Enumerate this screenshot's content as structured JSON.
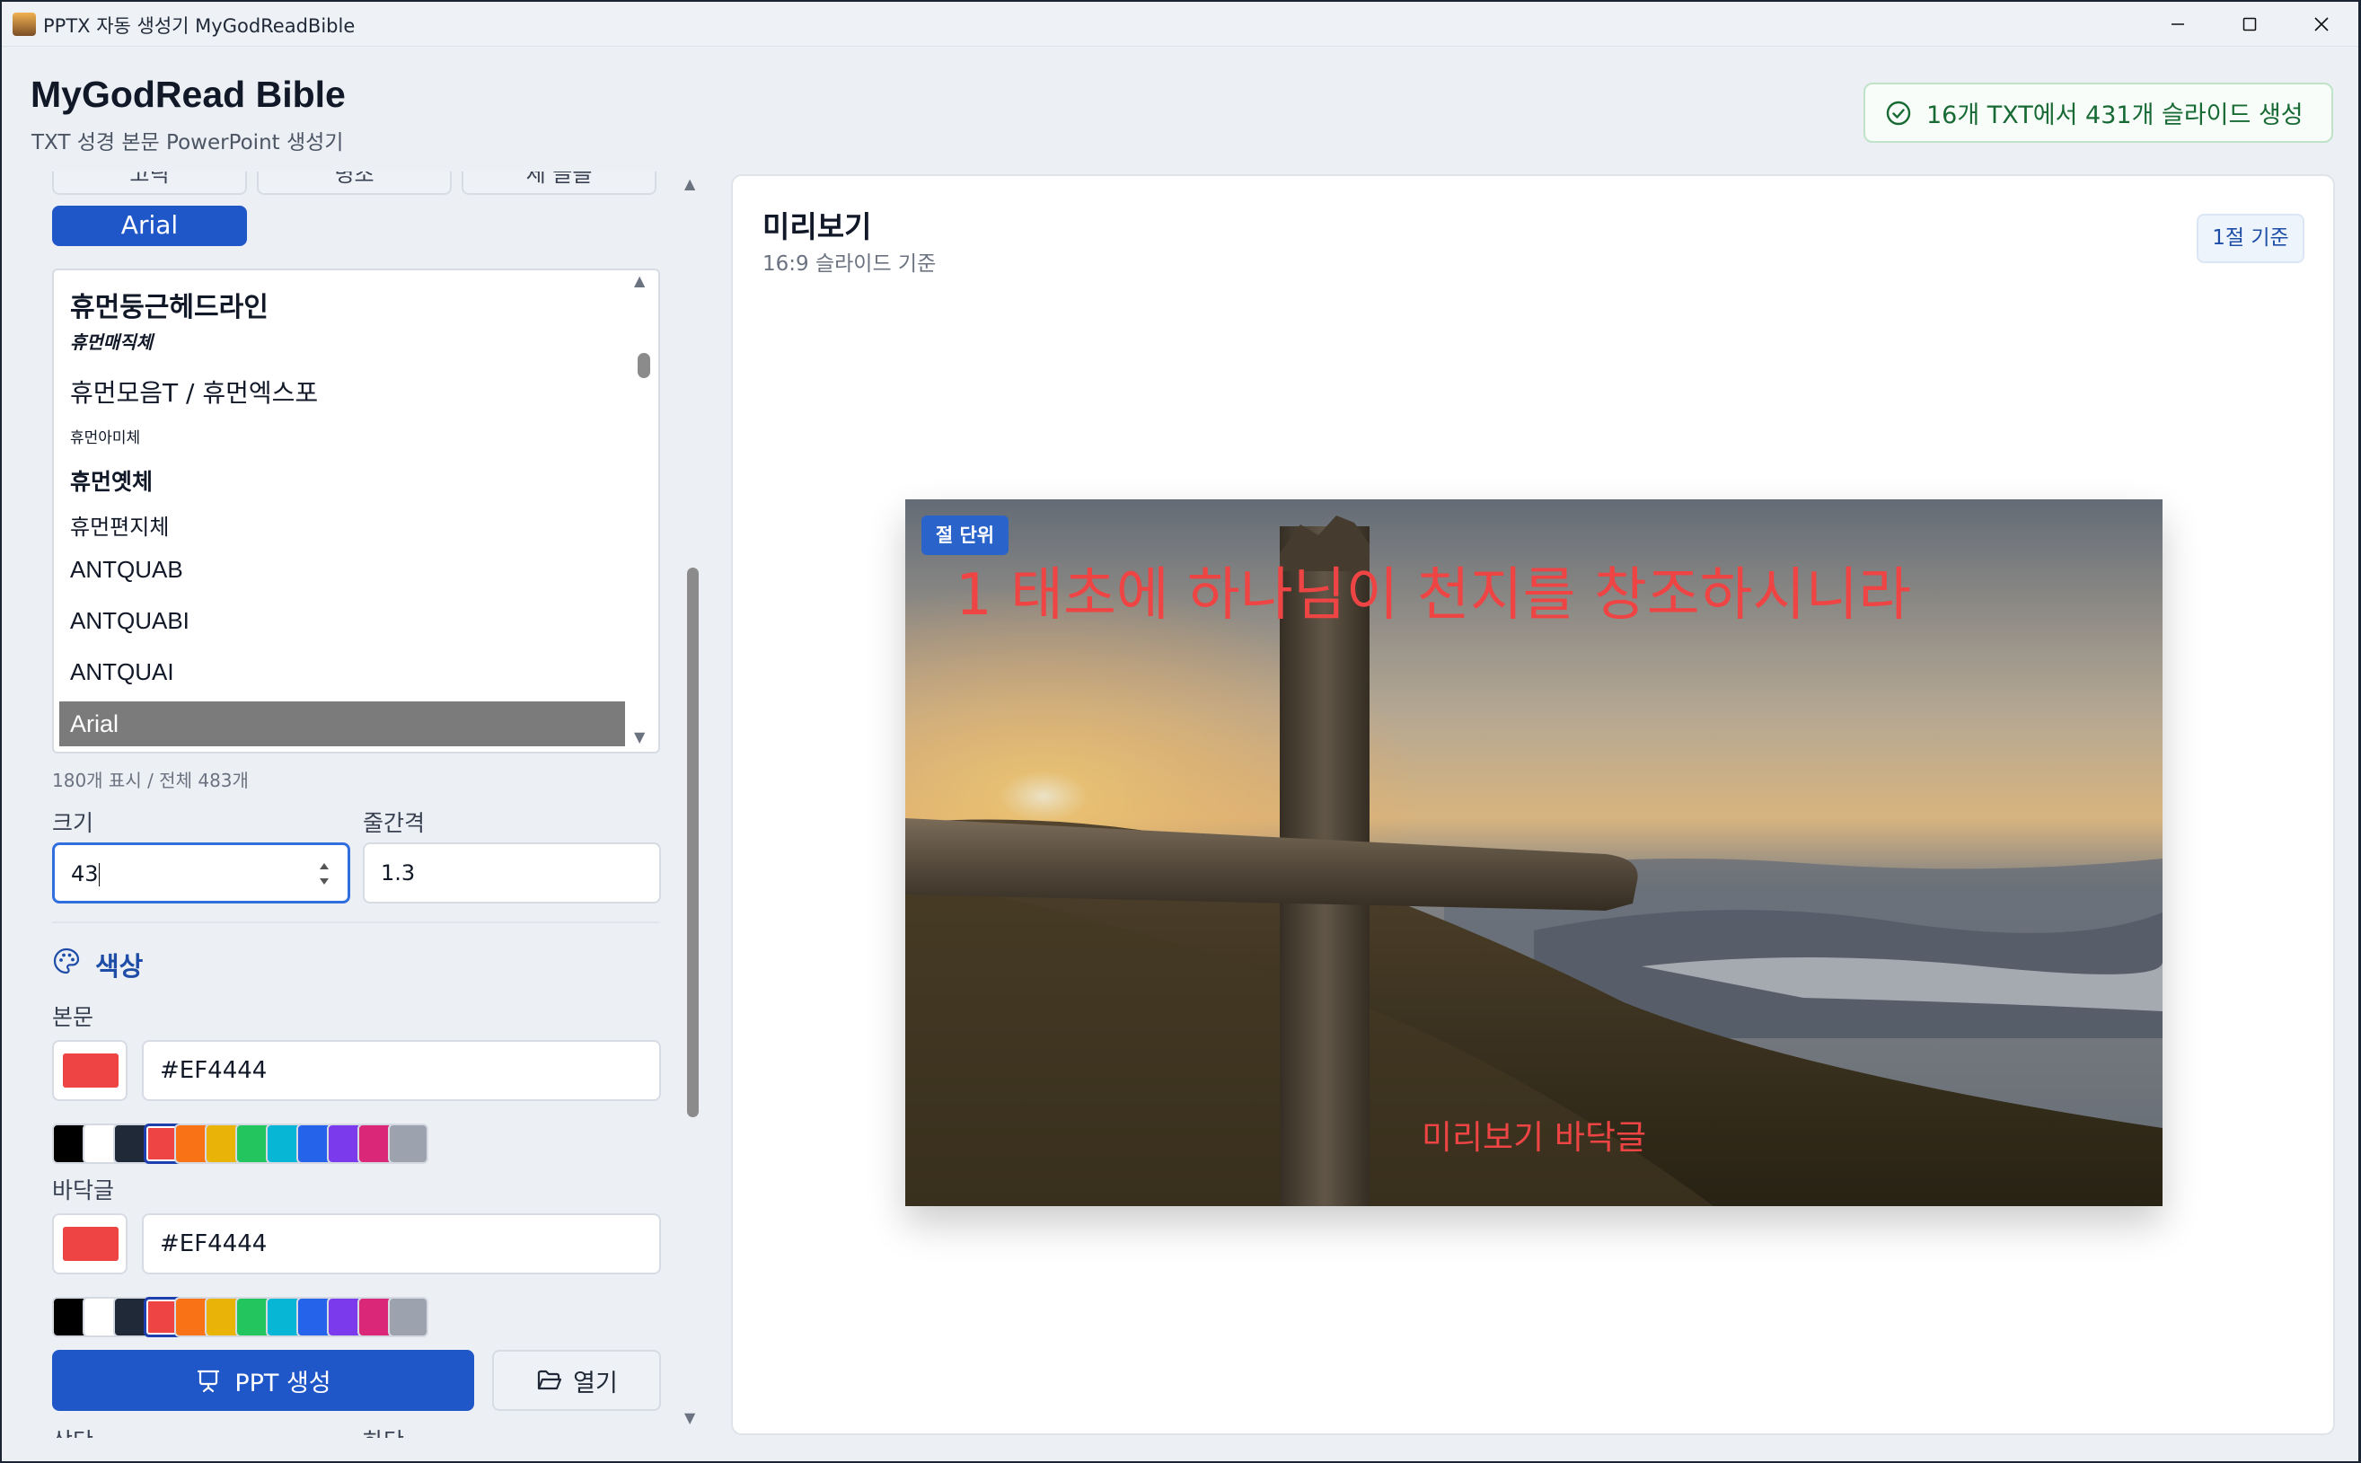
{
  "window": {
    "title": "PPTX 자동 생성기 MyGodReadBible"
  },
  "header": {
    "title": "MyGodRead Bible",
    "subtitle": "TXT 성경 본문 PowerPoint 생성기",
    "status": "16개 TXT에서 431개 슬라이드 생성"
  },
  "fonts": {
    "filter_buttons": [
      "고딕",
      "명조",
      "세 글꼴"
    ],
    "selected_button": "Arial",
    "list_items": [
      "휴먼둥근헤드라인",
      "휴먼매직체",
      "휴먼모음T / 휴먼엑스포",
      "휴먼아미체",
      "휴먼옛체",
      "휴먼편지체",
      "ANTQUAB",
      "ANTQUABI",
      "ANTQUAI",
      "Arial"
    ],
    "selected_item": "Arial",
    "count_text": "180개 표시 / 전체 483개"
  },
  "size": {
    "label": "크기",
    "value": "43"
  },
  "line_spacing": {
    "label": "줄간격",
    "value": "1.3"
  },
  "colors": {
    "section_title": "색상",
    "body": {
      "label": "본문",
      "value": "#EF4444",
      "color": "#EF4444"
    },
    "footer": {
      "label": "바닥글",
      "value": "#EF4444",
      "color": "#EF4444"
    },
    "palette": [
      "#000000",
      "#FFFFFF",
      "#1F2937",
      "#EF4444",
      "#F97316",
      "#EAB308",
      "#22C55E",
      "#06B6D4",
      "#2563EB",
      "#7C3AED",
      "#DB2777",
      "#9CA3AF"
    ],
    "selected_index": 3
  },
  "actions": {
    "generate": "PPT 생성",
    "open": "열기"
  },
  "bottom_labels": [
    "상단",
    "하단"
  ],
  "preview": {
    "title": "미리보기",
    "subtitle": "16:9 슬라이드 기준",
    "pill": "1절 기준",
    "badge": "절 단위",
    "verse_text": "1 태초에 하나님이 천지를 창조하시니라",
    "footer_text": "미리보기 바닥글"
  }
}
